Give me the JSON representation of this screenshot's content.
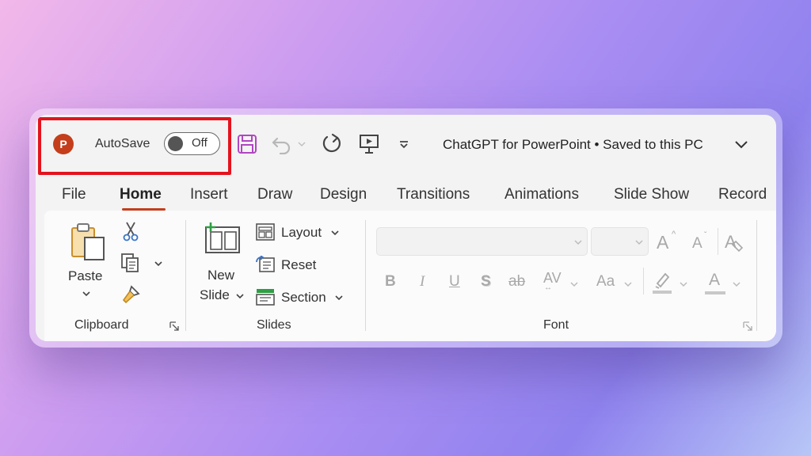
{
  "app": {
    "logo_letter": "P",
    "autosave_label": "AutoSave",
    "autosave_state": "Off",
    "document_title": "ChatGPT for PowerPoint • Saved to this PC"
  },
  "quick_access": [
    "save-icon",
    "undo-icon",
    "redo-icon",
    "present-from-beginning-icon",
    "customize-toolbar-icon"
  ],
  "tabs": [
    {
      "label": "File"
    },
    {
      "label": "Home",
      "active": true
    },
    {
      "label": "Insert"
    },
    {
      "label": "Draw"
    },
    {
      "label": "Design"
    },
    {
      "label": "Transitions"
    },
    {
      "label": "Animations"
    },
    {
      "label": "Slide Show"
    },
    {
      "label": "Record"
    }
  ],
  "ribbon": {
    "clipboard": {
      "label": "Clipboard",
      "paste_label": "Paste"
    },
    "slides": {
      "label": "Slides",
      "new_slide_line1": "New",
      "new_slide_line2": "Slide",
      "layout_label": "Layout",
      "reset_label": "Reset",
      "section_label": "Section"
    },
    "font": {
      "label": "Font",
      "bold": "B",
      "italic": "I",
      "underline": "U",
      "shadow": "S",
      "strikethrough": "ab",
      "spacing": "AV",
      "change_case": "Aa",
      "grow": "A",
      "shrink": "A",
      "font_color": "A"
    }
  },
  "colors": {
    "accent": "#c43e1c",
    "highlight": "#e4131e",
    "save_icon": "#b146c2"
  }
}
